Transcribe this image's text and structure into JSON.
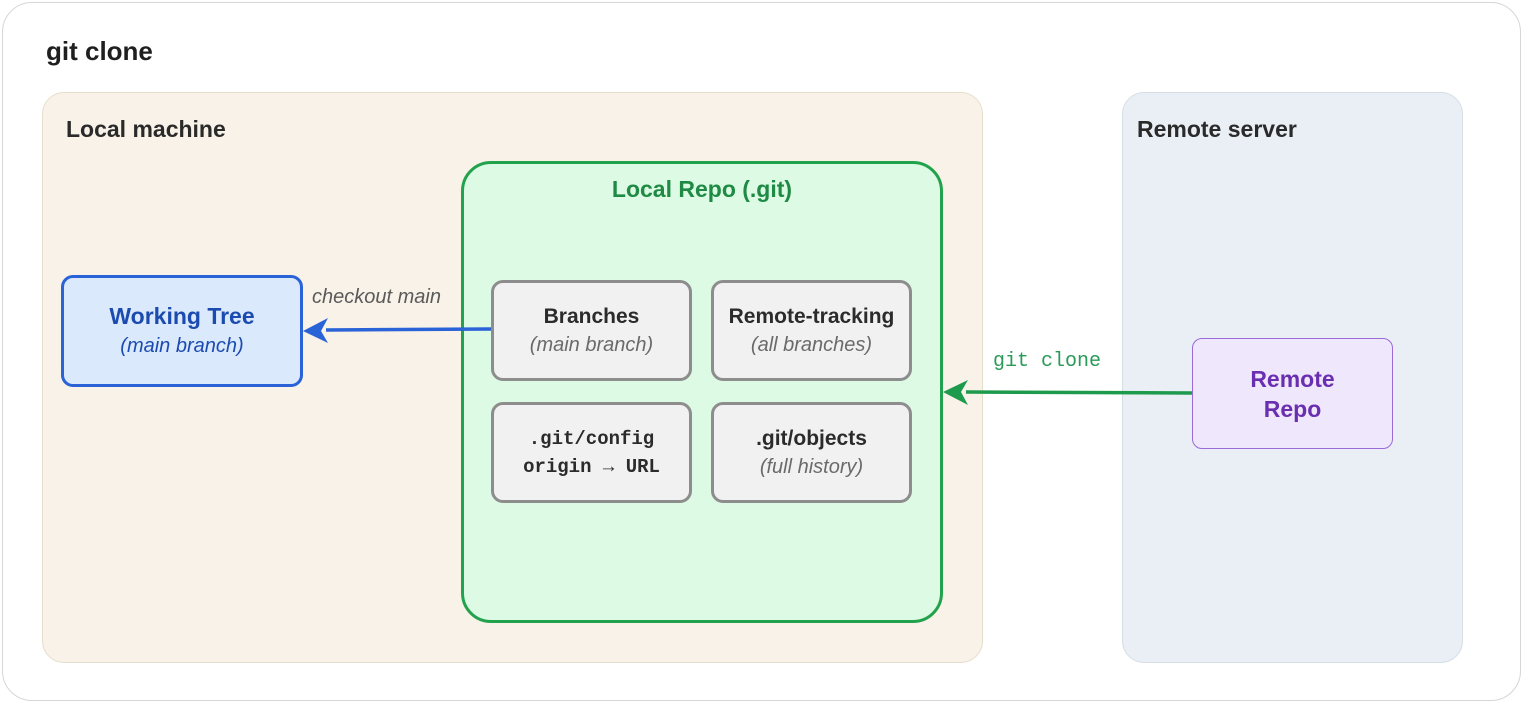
{
  "title": "git clone",
  "groups": {
    "local": {
      "label": "Local machine"
    },
    "remote": {
      "label": "Remote server"
    }
  },
  "local_repo": {
    "title": "Local Repo (.git)",
    "nodes": {
      "branches": {
        "main": "Branches",
        "sub": "(main branch)"
      },
      "remote_tracking": {
        "main": "Remote-tracking",
        "sub": "(all branches)"
      },
      "config": {
        "line1": ".git/config",
        "line2": "origin → URL"
      },
      "objects": {
        "main": ".git/objects",
        "sub": "(full history)"
      }
    }
  },
  "working_tree": {
    "main": "Working Tree",
    "sub": "(main branch)"
  },
  "remote_repo": {
    "label": "Remote Repo"
  },
  "edges": {
    "checkout": {
      "label": "checkout main"
    },
    "clone": {
      "label": "git clone"
    }
  },
  "colors": {
    "local_group_bg": "#f8f2e8",
    "remote_group_bg": "#eaeff5",
    "repo_border": "#22a24d",
    "repo_bg": "#dcfae4",
    "working_border": "#2a62d8",
    "remote_repo_border": "#9a6ad6",
    "checkout_arrow": "#2a62d8",
    "clone_arrow": "#1e9a4c"
  }
}
